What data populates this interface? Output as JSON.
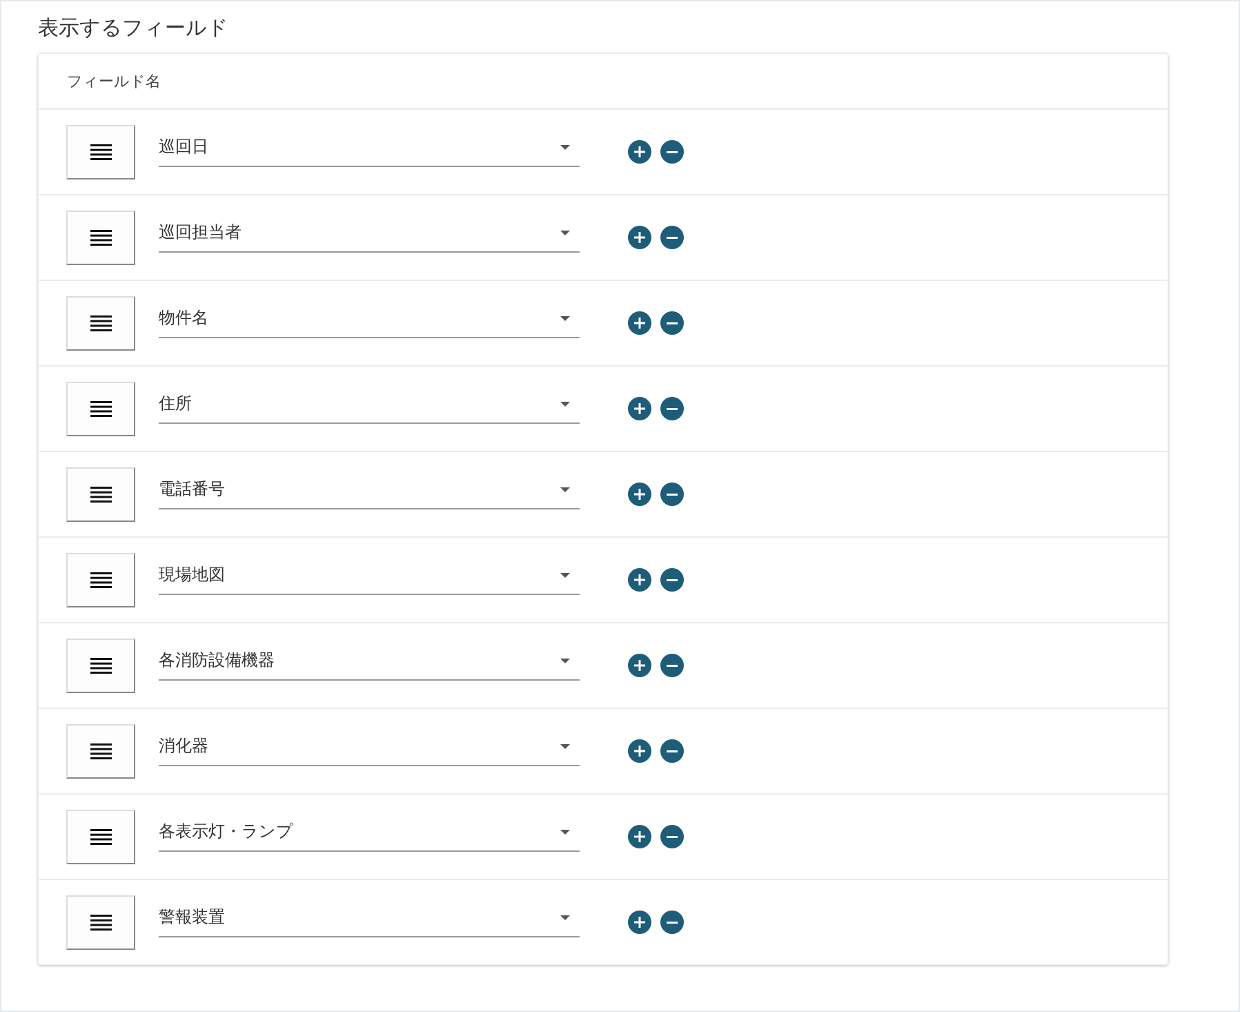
{
  "title": "表示するフィールド",
  "table": {
    "header": "フィールド名",
    "rows": [
      {
        "value": "巡回日"
      },
      {
        "value": "巡回担当者"
      },
      {
        "value": "物件名"
      },
      {
        "value": "住所"
      },
      {
        "value": "電話番号"
      },
      {
        "value": "現場地図"
      },
      {
        "value": "各消防設備機器"
      },
      {
        "value": "消化器"
      },
      {
        "value": "各表示灯・ランプ"
      },
      {
        "value": "警報装置"
      }
    ]
  }
}
